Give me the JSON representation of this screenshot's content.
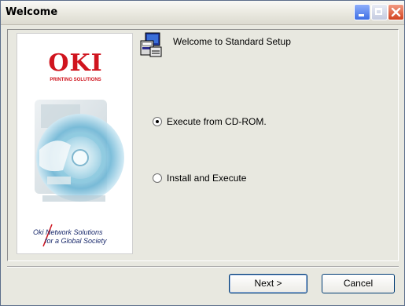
{
  "window": {
    "title": "Welcome"
  },
  "side_panel": {
    "logo_text": "OKI",
    "logo_subtitle": "PRINTING SOLUTIONS",
    "tagline_line1": "Oki Network Solutions",
    "tagline_line2": "for a Global Society"
  },
  "main": {
    "heading": "Welcome to Standard Setup",
    "options": [
      {
        "label": "Execute from CD-ROM.",
        "selected": true
      },
      {
        "label": "Install and Execute",
        "selected": false
      }
    ]
  },
  "buttons": {
    "next_label": "Next >",
    "cancel_label": "Cancel"
  },
  "colors": {
    "brand_red": "#d0141e",
    "close_button": "#d2421e",
    "minimize_button": "#3d6ee4"
  },
  "icons": [
    "minimize-icon",
    "maximize-icon",
    "close-icon",
    "setup-computer-icon"
  ]
}
